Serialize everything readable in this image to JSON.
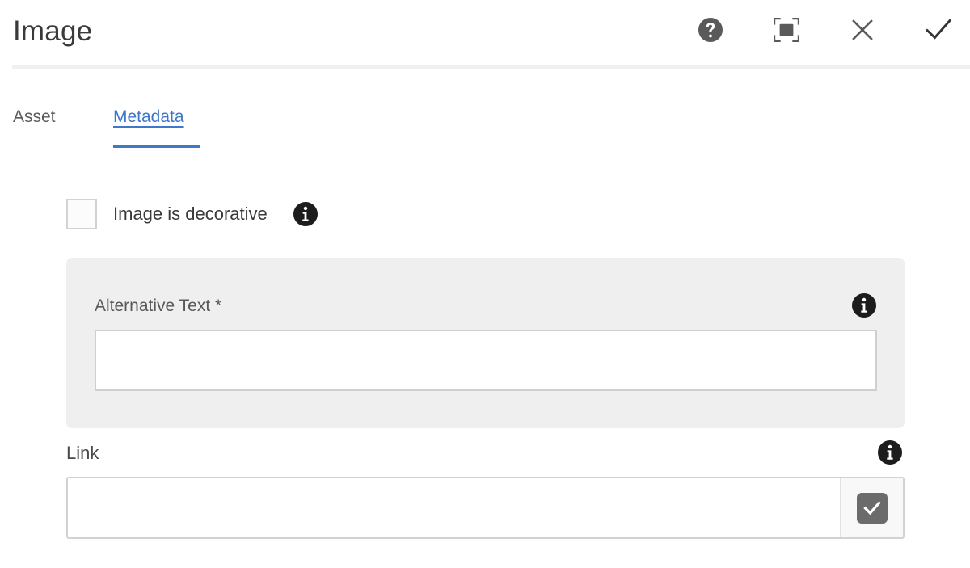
{
  "dialog": {
    "title": "Image",
    "actions": [
      {
        "name": "help-icon",
        "label": "Help"
      },
      {
        "name": "fullscreen-icon",
        "label": "Fullscreen"
      },
      {
        "name": "close-icon",
        "label": "Cancel"
      },
      {
        "name": "check-icon",
        "label": "Done"
      }
    ]
  },
  "tabs": [
    {
      "label": "Asset",
      "active": false
    },
    {
      "label": "Metadata",
      "active": true
    }
  ],
  "form": {
    "decorative": {
      "label": "Image is decorative",
      "checked": false,
      "info_icon": "info-icon"
    },
    "alternative_text": {
      "label": "Alternative Text *",
      "value": "",
      "placeholder": "",
      "info_icon": "info-icon"
    },
    "link": {
      "label": "Link",
      "value": "",
      "placeholder": "",
      "info_icon": "info-icon",
      "confirm_icon": "check-icon"
    }
  },
  "colors": {
    "accent": "#3f78c8",
    "panel_bg": "#efefef",
    "icon_gray": "#5a5a5a",
    "confirm_gray": "#6b6b6b",
    "info_black": "#1c1c1c"
  }
}
